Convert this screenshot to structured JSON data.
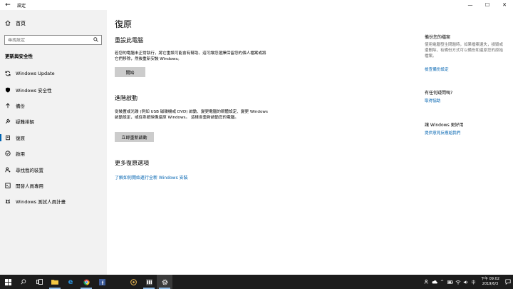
{
  "window": {
    "title": "設定",
    "controls": {
      "minimize": "—",
      "maximize": "☐",
      "close": "✕"
    }
  },
  "sidebar": {
    "home_label": "首頁",
    "search_placeholder": "尋找設定",
    "section_title": "更新與安全性",
    "items": [
      {
        "label": "Windows Update",
        "icon": "sync-icon"
      },
      {
        "label": "Windows 安全性",
        "icon": "shield-icon"
      },
      {
        "label": "備份",
        "icon": "backup-arrow-icon"
      },
      {
        "label": "疑難排解",
        "icon": "wrench-icon"
      },
      {
        "label": "復原",
        "icon": "recovery-icon",
        "active": true
      },
      {
        "label": "啟用",
        "icon": "check-circle-icon"
      },
      {
        "label": "尋找我的裝置",
        "icon": "person-pin-icon"
      },
      {
        "label": "開發人員專用",
        "icon": "developer-icon"
      },
      {
        "label": "Windows 測試人員計畫",
        "icon": "insider-icon"
      }
    ]
  },
  "main": {
    "title": "復原",
    "reset": {
      "heading": "重設此電腦",
      "description": "若您的電腦未正常執行，將它重設可能會有幫助。這可讓您選擇保留您的個人檔案或將它們移除，然後重新安裝 Windows。",
      "button": "開始"
    },
    "advanced": {
      "heading": "進階啟動",
      "description": "從裝置或光碟 (例如 USB 磁碟機或 DVD) 啟動、變更電腦的韌體設定、變更 Windows 啟動設定，或從系統映像還原 Windows。 這樣會重新啟動您的電腦。",
      "button": "立即重新啟動"
    },
    "more": {
      "heading": "更多復原選項",
      "link": "了解如何開始進行全新 Windows 安裝"
    }
  },
  "right_panel": {
    "backup": {
      "heading": "備份您的檔案",
      "text": "使用電腦發生問題時，如果檔案遺失，損毀或遭刪除，有備份方式可以備份和還原您的原始檔案。",
      "link": "檢查備份設定"
    },
    "help": {
      "heading": "有任何疑問嗎?",
      "link": "取得協助"
    },
    "feedback": {
      "heading": "讓 Windows 更好用",
      "link": "提供意見反應給我們"
    }
  },
  "taskbar": {
    "clock_time": "下午 09:02",
    "clock_date": "2019/6/3"
  }
}
